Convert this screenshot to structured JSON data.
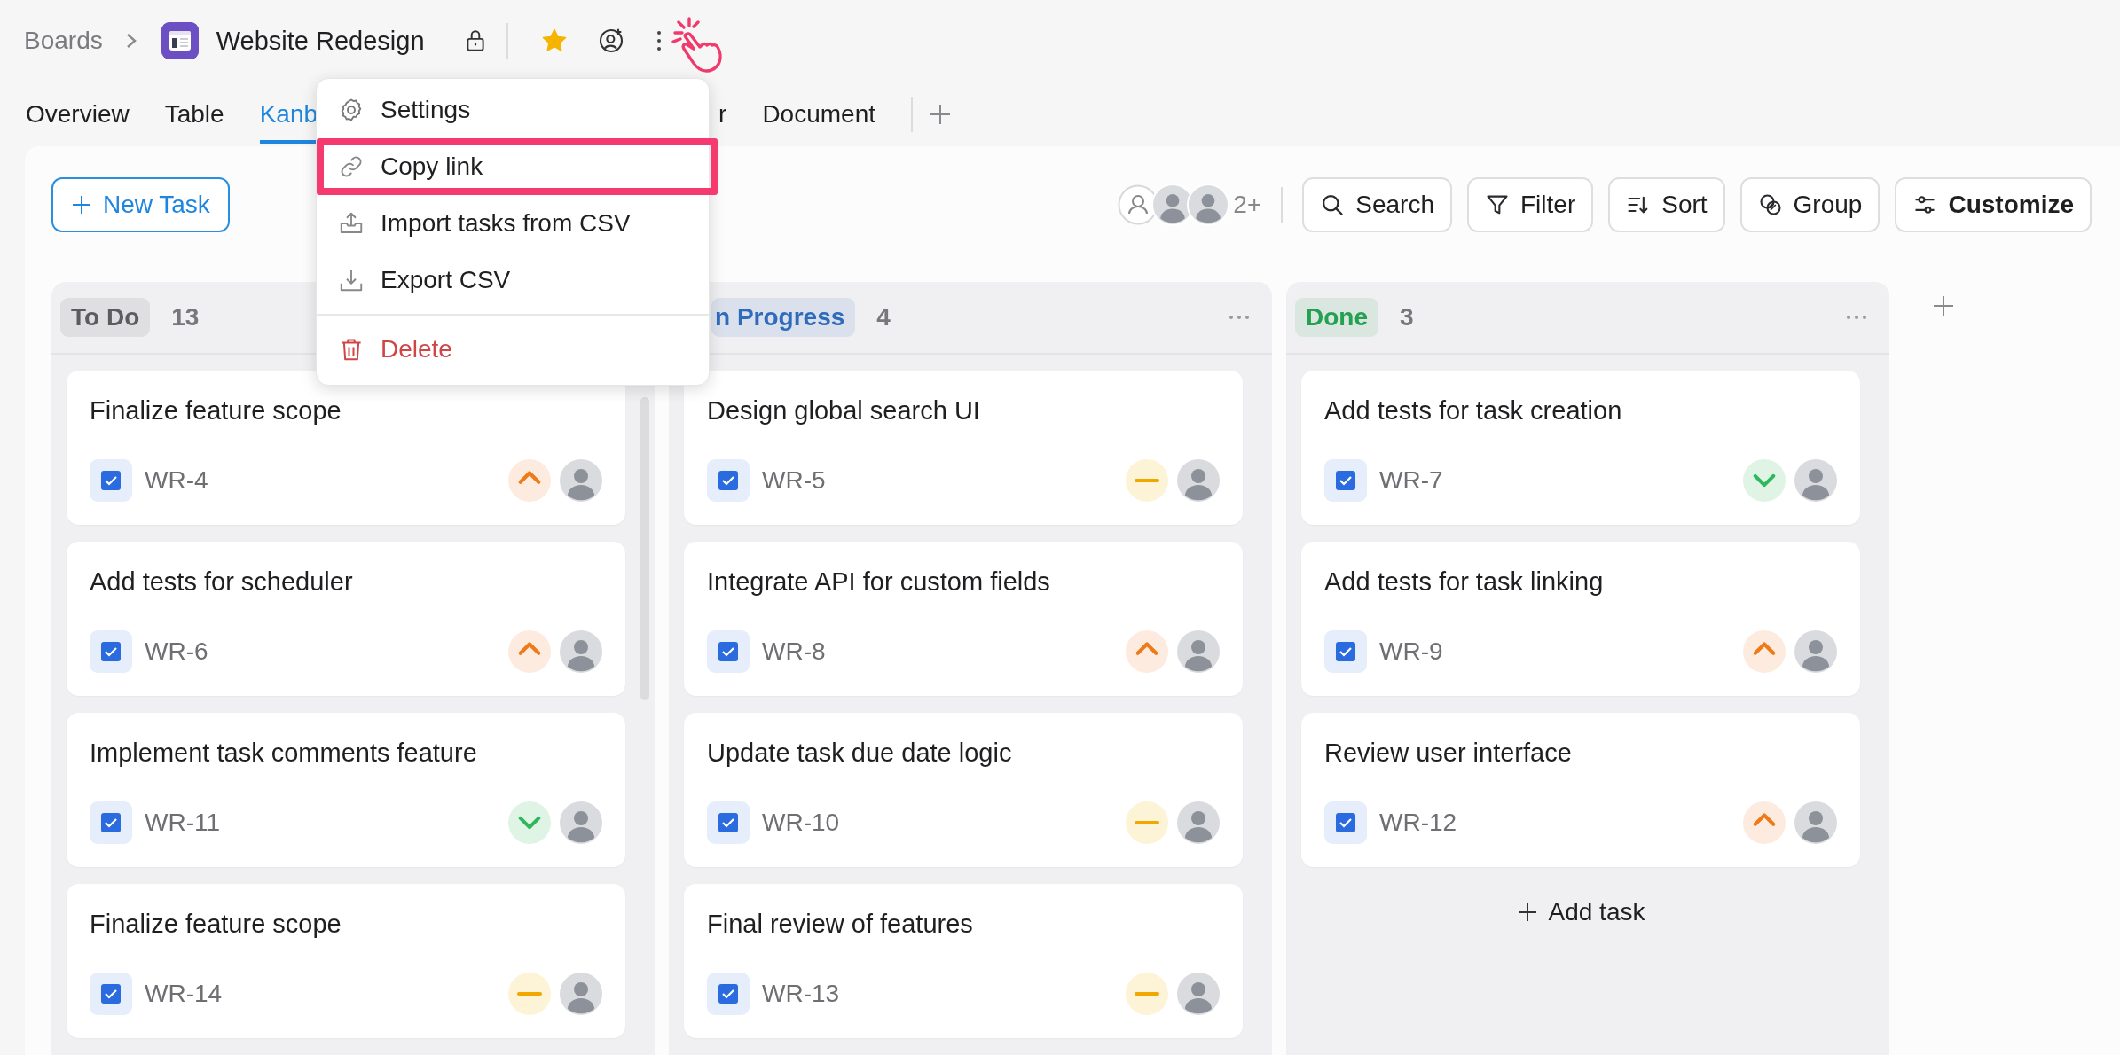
{
  "breadcrumb": {
    "parent": "Boards",
    "title": "Website Redesign",
    "locked": true,
    "starred": true
  },
  "tabs": [
    {
      "label": "Overview",
      "selected": false
    },
    {
      "label": "Table",
      "selected": false
    },
    {
      "label": "Kanb",
      "selected": true
    },
    {
      "label": "r",
      "selected": false
    },
    {
      "label": "Document",
      "selected": false
    }
  ],
  "menu": {
    "items": [
      {
        "label": "Settings",
        "kind": "settings",
        "highlighted": false
      },
      {
        "label": "Copy link",
        "kind": "link",
        "highlighted": true
      },
      {
        "label": "Import tasks from CSV",
        "kind": "import",
        "highlighted": false
      },
      {
        "label": "Export CSV",
        "kind": "export",
        "highlighted": false
      },
      {
        "label": "Delete",
        "kind": "delete",
        "highlighted": false
      }
    ]
  },
  "toolbar": {
    "new_task": "New Task",
    "member_count": "2+",
    "buttons": [
      {
        "label": "Search",
        "kind": "search"
      },
      {
        "label": "Filter",
        "kind": "filter"
      },
      {
        "label": "Sort",
        "kind": "sort"
      },
      {
        "label": "Group",
        "kind": "group"
      },
      {
        "label": "Customize",
        "kind": "customize"
      }
    ]
  },
  "columns": [
    {
      "title": "To Do",
      "count": "13",
      "color": "#5c5c60",
      "more": false,
      "scrollbar": true,
      "cards": [
        {
          "title": "Finalize feature scope",
          "id": "WR-4",
          "kind": "high"
        },
        {
          "title": "Add tests for scheduler",
          "id": "WR-6",
          "kind": "high"
        },
        {
          "title": "Implement task comments feature",
          "id": "WR-11",
          "kind": "low"
        },
        {
          "title": "Finalize feature scope",
          "id": "WR-14",
          "kind": "medium"
        }
      ]
    },
    {
      "title": "n Progress",
      "count": "4",
      "color": "#2f6bbd",
      "more": true,
      "scrollbar": false,
      "cards": [
        {
          "title": "Design global search UI",
          "id": "WR-5",
          "kind": "medium"
        },
        {
          "title": "Integrate API for custom fields",
          "id": "WR-8",
          "kind": "high"
        },
        {
          "title": "Update task due date logic",
          "id": "WR-10",
          "kind": "medium"
        },
        {
          "title": "Final review of features",
          "id": "WR-13",
          "kind": "medium"
        }
      ]
    },
    {
      "title": "Done",
      "count": "3",
      "color": "#24a150",
      "more": true,
      "scrollbar": false,
      "add_task": "Add task",
      "cards": [
        {
          "title": "Add tests for task creation",
          "id": "WR-7",
          "kind": "low"
        },
        {
          "title": "Add tests for task linking",
          "id": "WR-9",
          "kind": "high"
        },
        {
          "title": "Review user interface",
          "id": "WR-12",
          "kind": "high"
        }
      ]
    }
  ]
}
